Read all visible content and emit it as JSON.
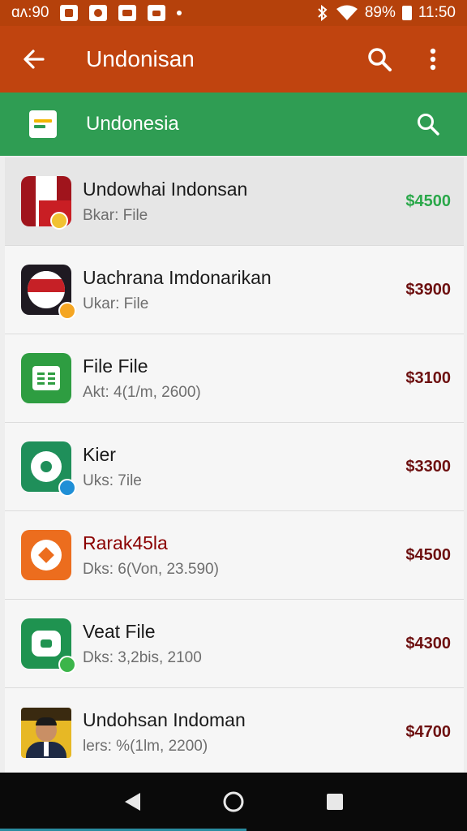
{
  "status_bar": {
    "left_text": "ɑʌ:90",
    "battery": "89%",
    "time": "11:50"
  },
  "app_bar": {
    "title": "Undonisan",
    "icons": [
      "back-arrow-icon",
      "search-icon",
      "more-vert-icon"
    ]
  },
  "sub_bar": {
    "title": "Undonesia",
    "icons": [
      "document-icon",
      "search-icon"
    ]
  },
  "items": [
    {
      "title": "Undowhai Indonsan",
      "subtitle": "Bkar: File",
      "price": "$4500",
      "icon": "red-white-flag-icon",
      "badge": "yellow-circle-badge"
    },
    {
      "title": "Uachrana Imdonarikan",
      "subtitle": "Ukar: File",
      "price": "$3900",
      "icon": "flag-circle-icon",
      "badge": "yellow-check-badge"
    },
    {
      "title": "File File",
      "subtitle": "Akt: 4(1/m, 2600)",
      "price": "$3100",
      "icon": "spreadsheet-icon",
      "badge": ""
    },
    {
      "title": "Kier",
      "subtitle": "Uks: 7ile",
      "price": "$3300",
      "icon": "green-ring-icon",
      "badge": "blue-check-badge"
    },
    {
      "title": "Rarak45la",
      "subtitle": "Dks: 6(Von, 23.590)",
      "price": "$4500",
      "icon": "orange-diamond-icon",
      "badge": ""
    },
    {
      "title": "Veat File",
      "subtitle": "Dks: 3,2bis, 2100",
      "price": "$4300",
      "icon": "green-rounded-square-icon",
      "badge": "green-check-badge"
    },
    {
      "title": "Undohsan Indoman",
      "subtitle": "lers: %(1lm, 2200)",
      "price": "$4700",
      "icon": "portrait-photo-icon",
      "badge": ""
    }
  ],
  "colors": {
    "app_bar": "#c0440f",
    "sub_bar": "#2f9d53",
    "price_highlight": "#2aa84a",
    "price": "#6d1010",
    "highlight_title": "#8b0000"
  },
  "nav_bar": {
    "icons": [
      "back-triangle-icon",
      "home-circle-icon",
      "recents-square-icon"
    ]
  }
}
